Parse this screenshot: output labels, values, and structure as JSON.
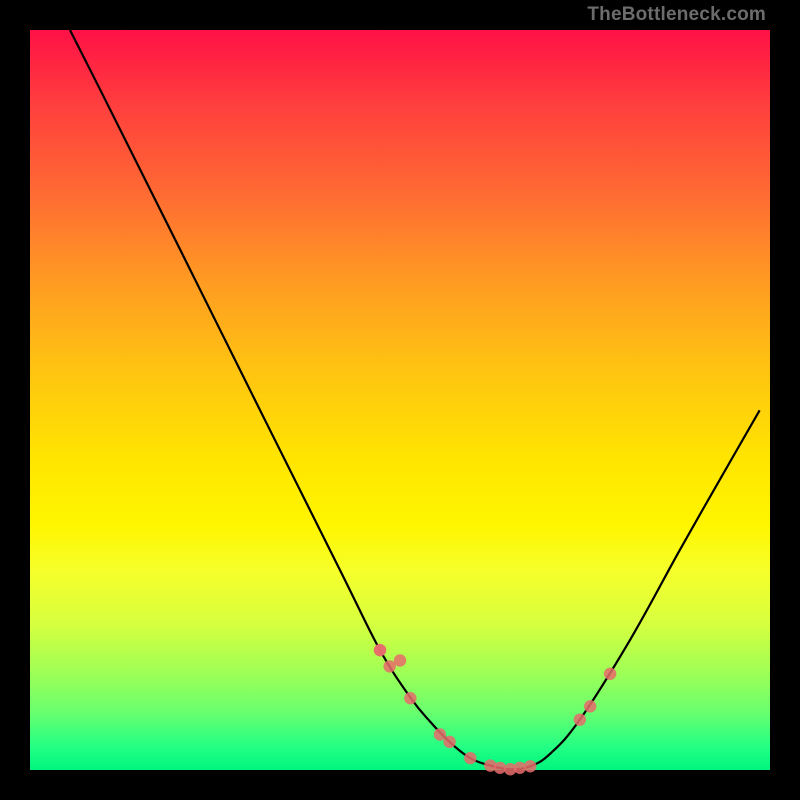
{
  "watermark": "TheBottleneck.com",
  "chart_data": {
    "type": "line",
    "title": "",
    "xlabel": "",
    "ylabel": "",
    "xlim": [
      0,
      100
    ],
    "ylim": [
      0,
      100
    ],
    "grid": false,
    "background_gradient": [
      "#ff1146",
      "#ffe500",
      "#00f57e"
    ],
    "series": [
      {
        "name": "curve",
        "color": "#000000",
        "x": [
          5.4,
          9.5,
          20.3,
          31.1,
          41.9,
          47.3,
          51.4,
          54.1,
          56.7,
          59.5,
          62.2,
          64.9,
          67.6,
          70.3,
          74.3,
          81.1,
          87.8,
          93.2,
          98.6
        ],
        "y": [
          100,
          91.9,
          70.3,
          48.6,
          27.0,
          16.2,
          9.8,
          6.5,
          3.8,
          1.6,
          0.6,
          0.1,
          0.5,
          2.2,
          6.8,
          17.6,
          29.7,
          39.2,
          48.6
        ]
      },
      {
        "name": "points",
        "color": "#e86b6b",
        "type": "scatter",
        "x": [
          47.3,
          48.6,
          50.0,
          51.4,
          55.4,
          56.7,
          59.5,
          62.2,
          63.5,
          64.9,
          66.2,
          67.6,
          74.3,
          75.7,
          78.4,
          47.3
        ],
        "y": [
          16.2,
          14.0,
          14.8,
          9.7,
          4.8,
          3.8,
          1.6,
          0.6,
          0.3,
          0.1,
          0.3,
          0.5,
          6.8,
          8.6,
          13.0,
          16.2
        ]
      }
    ]
  }
}
